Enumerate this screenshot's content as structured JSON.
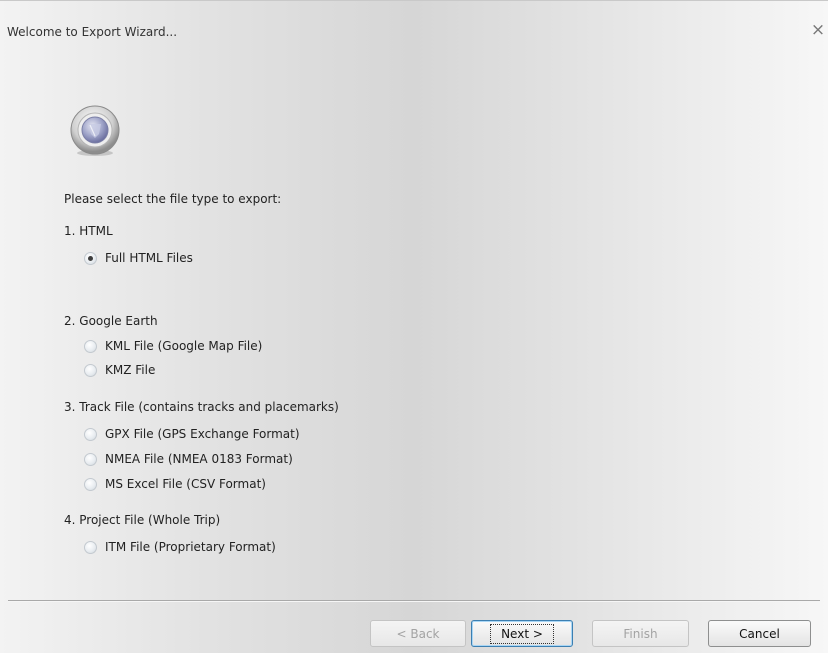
{
  "window": {
    "title": "Welcome to Export Wizard...",
    "close_glyph": "×"
  },
  "icon": "wizard-badge-icon",
  "prompt": "Please select the file type to export:",
  "groups": [
    {
      "label": "1. HTML",
      "options": [
        {
          "label": "Full HTML Files",
          "checked": true
        }
      ]
    },
    {
      "label": "2. Google Earth",
      "options": [
        {
          "label": "KML File (Google Map File)",
          "checked": false
        },
        {
          "label": "KMZ File",
          "checked": false
        }
      ]
    },
    {
      "label": "3. Track File (contains tracks and placemarks)",
      "options": [
        {
          "label": "GPX File (GPS Exchange Format)",
          "checked": false
        },
        {
          "label": "NMEA File (NMEA 0183 Format)",
          "checked": false
        },
        {
          "label": "MS Excel File (CSV Format)",
          "checked": false
        }
      ]
    },
    {
      "label": "4. Project File (Whole Trip)",
      "options": [
        {
          "label": "ITM File (Proprietary Format)",
          "checked": false
        }
      ]
    }
  ],
  "buttons": {
    "back": "< Back",
    "next": "Next >",
    "finish": "Finish",
    "cancel": "Cancel"
  },
  "colors": {
    "background_light": "#f3f3f3",
    "background_mid": "#d6d6d6",
    "default_button_border": "#3c7fb1",
    "disabled_text": "#a3a3a3"
  }
}
